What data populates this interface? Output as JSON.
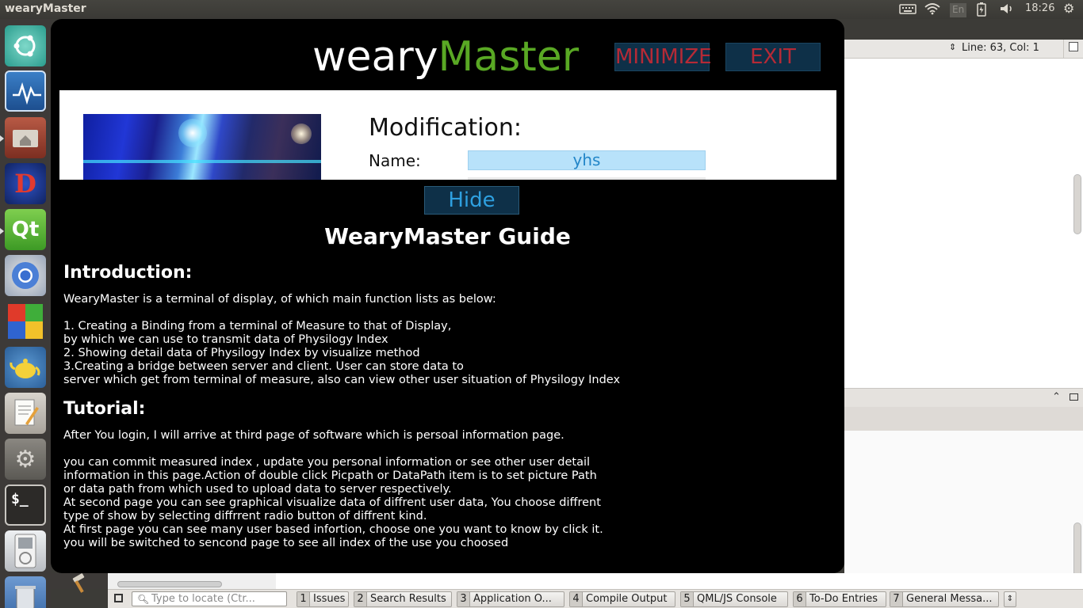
{
  "top_panel": {
    "title": "wearyMaster",
    "keyboard_layout": "En",
    "time": "18:26",
    "icons": [
      "keyboard-icon",
      "wifi-icon",
      "keyboard-layout-indicator",
      "battery-icon",
      "volume-icon",
      "gear-icon"
    ]
  },
  "launcher": {
    "items": [
      {
        "name": "ubuntu-dash-icon",
        "glyph": "◎"
      },
      {
        "name": "system-monitor-icon",
        "glyph": "〜"
      },
      {
        "name": "files-icon",
        "glyph": "⌂"
      },
      {
        "name": "d-app-icon",
        "glyph": "D"
      },
      {
        "name": "qt-creator-icon",
        "glyph": "Qt"
      },
      {
        "name": "chromium-icon",
        "glyph": "◯"
      },
      {
        "name": "color-blocks-icon",
        "glyph": ""
      },
      {
        "name": "teapot-icon",
        "glyph": "☕"
      },
      {
        "name": "text-editor-icon",
        "glyph": "✎"
      },
      {
        "name": "settings-icon",
        "glyph": "⚙"
      },
      {
        "name": "terminal-icon",
        "glyph": "$_"
      },
      {
        "name": "ipod-icon",
        "glyph": "◉"
      },
      {
        "name": "trash-icon",
        "glyph": "🗑"
      }
    ]
  },
  "ide": {
    "cursor_position": "Line: 63, Col: 1",
    "locator_placeholder": "Type to locate (Ctr...",
    "panes": [
      {
        "num": "1",
        "label": "Issues"
      },
      {
        "num": "2",
        "label": "Search Results"
      },
      {
        "num": "3",
        "label": "Application O..."
      },
      {
        "num": "4",
        "label": "Compile Output"
      },
      {
        "num": "5",
        "label": "QML/JS Console"
      },
      {
        "num": "6",
        "label": "To-Do Entries"
      },
      {
        "num": "7",
        "label": "General Messa..."
      }
    ]
  },
  "app": {
    "title_prefix": "weary",
    "title_accent": "Master",
    "minimize_label": "MINIMIZE",
    "exit_label": "EXIT",
    "modification_title": "Modification:",
    "name_label": "Name:",
    "name_value": "yhs",
    "hide_label": "Hide",
    "guide_title": "WearyMaster Guide",
    "intro_heading": "Introduction:",
    "intro_lead": "WearyMaster is a terminal of display, of which main function lists as below:",
    "intro_items": "1. Creating a Binding from a terminal of Measure to that of Display,\nby which we can use to transmit data of Physilogy Index\n2. Showing detail data of Physilogy Index by visualize method\n3.Creating a bridge between server and client. User can store data to\nserver which get from terminal of measure, also can view other user situation of Physilogy Index",
    "tutorial_heading": "Tutorial:",
    "tutorial_lead": "After You login, I will arrive at third page of software which is persoal information page.",
    "tutorial_body": "you can commit measured index , update you personal information or see other user detail\ninformation in this page.Action of double click Picpath or DataPath item is to set picture Path\nor data path from which used to upload data to server respectively.\nAt second page you can see graphical visualize data of diffrent user data, You choose diffrent\ntype of show by selecting diffrrent radio button of diffrent kind.\nAt first page you can see many user based infortion, choose one you want to know by click it.\nyou will be switched to sencond page to see all index of the use you choosed"
  },
  "colors": {
    "accent_green": "#59a824",
    "button_bg": "#0e3048",
    "button_red_text": "#b52a36",
    "button_blue_text": "#2ea0e0",
    "name_field_bg": "#b8e2fa"
  }
}
